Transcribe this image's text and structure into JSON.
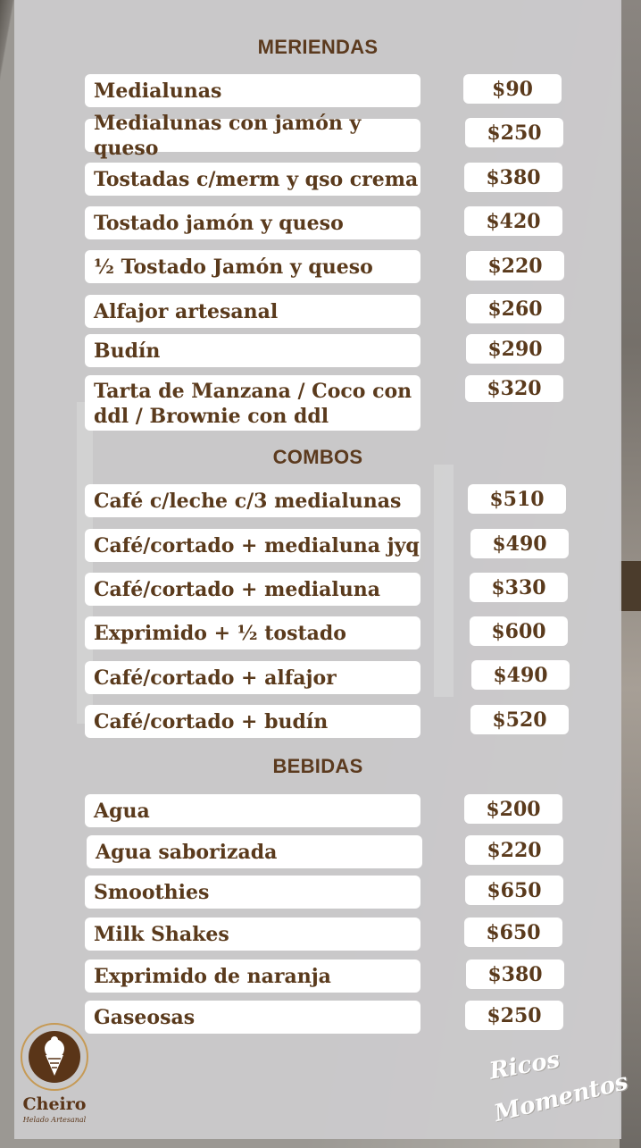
{
  "colors": {
    "text": "#5a3a1c",
    "panel": "#cccbce",
    "pill": "#ffffff",
    "accent": "#c69a55"
  },
  "sections": {
    "meriendas": {
      "title": "MERIENDAS",
      "items": [
        {
          "name": "Medialunas",
          "price": "$90"
        },
        {
          "name": "Medialunas con jamón y queso",
          "price": "$250"
        },
        {
          "name": "Tostadas c/merm y qso crema",
          "price": "$380"
        },
        {
          "name": "Tostado jamón y queso",
          "price": "$420"
        },
        {
          "name": "½ Tostado Jamón y queso",
          "price": "$220"
        },
        {
          "name": "Alfajor artesanal",
          "price": "$260"
        },
        {
          "name": "Budín",
          "price": "$290"
        },
        {
          "name": "Tarta de Manzana / Coco con ddl / Brownie con ddl",
          "price": "$320"
        }
      ]
    },
    "combos": {
      "title": "COMBOS",
      "items": [
        {
          "name": "Café c/leche c/3 medialunas",
          "price": "$510"
        },
        {
          "name": "Café/cortado + medialuna jyq",
          "price": "$490"
        },
        {
          "name": "Café/cortado + medialuna",
          "price": "$330"
        },
        {
          "name": "Exprimido + ½ tostado",
          "price": "$600"
        },
        {
          "name": "Café/cortado + alfajor",
          "price": "$490"
        },
        {
          "name": "Café/cortado + budín",
          "price": "$520"
        }
      ]
    },
    "bebidas": {
      "title": "BEBIDAS",
      "items": [
        {
          "name": "Agua",
          "price": "$200"
        },
        {
          "name": "Agua saborizada",
          "price": "$220"
        },
        {
          "name": "Smoothies",
          "price": "$650"
        },
        {
          "name": "Milk Shakes",
          "price": "$650"
        },
        {
          "name": "Exprimido de naranja",
          "price": "$380"
        },
        {
          "name": "Gaseosas",
          "price": "$250"
        }
      ]
    }
  },
  "logo": {
    "name": "Cheiro",
    "subtitle": "Helado Artesanal",
    "icon": "ice-cream-cone-icon"
  },
  "tagline": {
    "line1": "Ricos",
    "line2": "Momentos"
  }
}
